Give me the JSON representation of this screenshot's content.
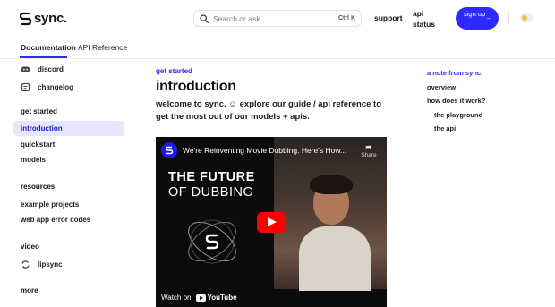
{
  "header": {
    "logo_text": "sync.",
    "search_placeholder": "Search or ask...",
    "search_shortcut": "Ctrl K",
    "support_label": "support",
    "status_label": "api status",
    "signup_label": "sign up",
    "signup_arrow": "→",
    "accent_color": "#2d2aff"
  },
  "tabs": [
    {
      "label": "Documentation",
      "active": true
    },
    {
      "label": "API Reference",
      "active": false
    }
  ],
  "sidebar": {
    "links": [
      {
        "label": "discord",
        "icon": "discord-icon"
      },
      {
        "label": "changelog",
        "icon": "changelog-icon"
      }
    ],
    "sections": [
      {
        "heading": "get started",
        "items": [
          "introduction",
          "quickstart",
          "models"
        ]
      },
      {
        "heading": "resources",
        "items": [
          "example projects",
          "web app error codes"
        ]
      },
      {
        "heading": "video",
        "items": [
          "lipsync"
        ]
      },
      {
        "heading": "more",
        "items": []
      }
    ],
    "active_item": "introduction"
  },
  "main": {
    "breadcrumb": "get started",
    "title": "introduction",
    "intro": "welcome to sync. ☺ explore our guide / api reference to get the most out of our models + apis."
  },
  "video": {
    "title": "We're Reinventing Movie Dubbing. Here's How...",
    "share_label": "Share",
    "headline_1": "THE FUTURE",
    "headline_2": "OF DUBBING",
    "watch_on": "Watch on",
    "youtube_label": "YouTube"
  },
  "toc": [
    {
      "label": "a note from sync.",
      "active": true,
      "indent": false
    },
    {
      "label": "overview",
      "active": false,
      "indent": false
    },
    {
      "label": "how does it work?",
      "active": false,
      "indent": false
    },
    {
      "label": "the playground",
      "active": false,
      "indent": true
    },
    {
      "label": "the api",
      "active": false,
      "indent": true
    }
  ]
}
